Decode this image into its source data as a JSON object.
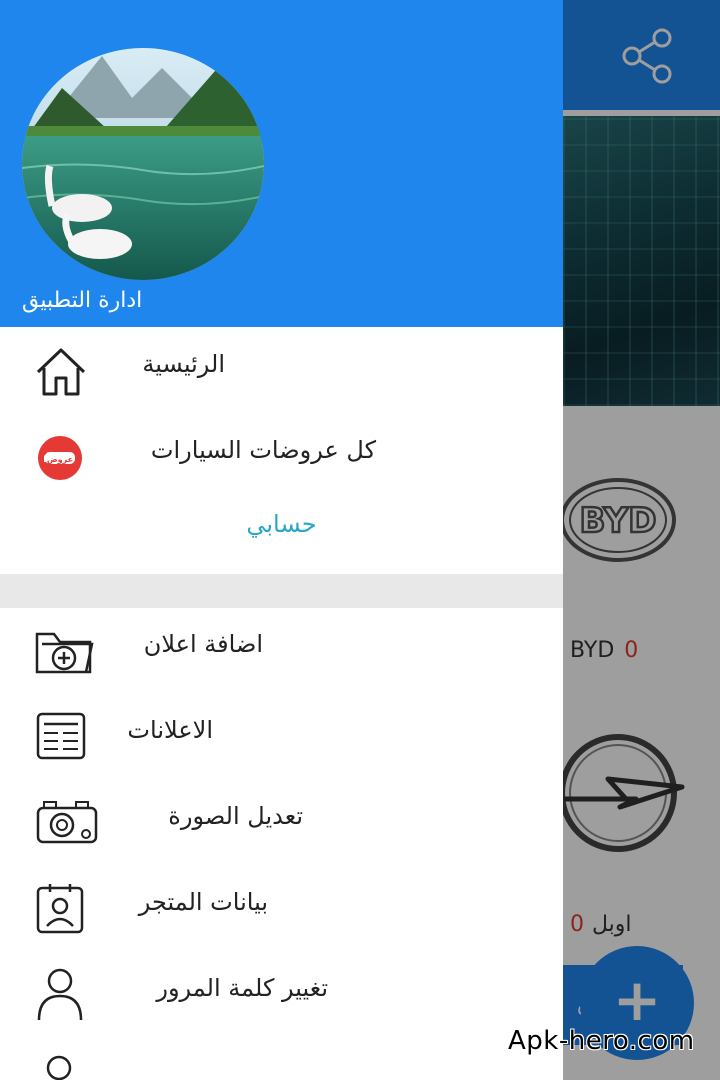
{
  "background": {
    "brand_label": "BYD",
    "brand_count": "0",
    "opel_label": "اوبل",
    "opel_count": "0",
    "add_pill_text": "اض",
    "fab_symbol": "+"
  },
  "drawer": {
    "header_title": "ادارة التطبيق",
    "items": [
      {
        "label": "الرئيسية",
        "icon": "home-icon"
      },
      {
        "label": "كل عروضات السيارات",
        "icon": "offers-badge-icon"
      }
    ],
    "section_header": "حسابي",
    "account_items": [
      {
        "label": "اضافة اعلان",
        "icon": "folder-add-icon"
      },
      {
        "label": "الاعلانات",
        "icon": "list-document-icon"
      },
      {
        "label": "تعديل الصورة",
        "icon": "camera-icon"
      },
      {
        "label": "بيانات المتجر",
        "icon": "id-card-icon"
      },
      {
        "label": "تغيير كلمة المرور",
        "icon": "user-icon"
      }
    ]
  },
  "colors": {
    "primary": "#1f86ee",
    "section_header": "#2aa7c4",
    "count_red": "#e23b2e"
  },
  "watermark": "Apk-hero.com"
}
